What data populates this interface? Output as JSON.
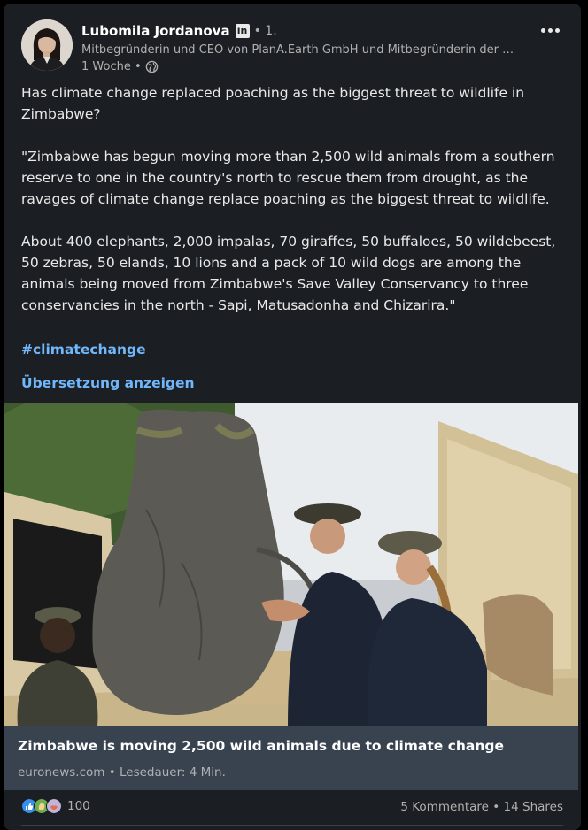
{
  "post": {
    "author_name": "Lubomila Jordanova",
    "linkedin_badge": "in",
    "degree": "• 1.",
    "headline": "Mitbegründerin und CEO von PlanA.Earth GmbH und Mitbegründerin der …",
    "time": "1 Woche •",
    "globe_icon": "globe-icon",
    "more_icon": "more-horizontal-icon",
    "text_p1": "Has climate change replaced poaching as the biggest threat to wildlife in Zimbabwe?",
    "text_p2": "\"Zimbabwe has begun moving more than 2,500 wild animals from a southern reserve to one in the country's north to rescue them from drought, as the ravages of climate change replace poaching as the biggest threat to wildlife.",
    "text_p3": "About 400 elephants, 2,000 impalas, 70 giraffes, 50 buffaloes, 50 wildebeest, 50 zebras, 50 elands, 10 lions and a pack of 10 wild dogs are among the animals being moved from Zimbabwe's Save Valley Conservancy to three conservancies in the north - Sapi, Matusadonha and Chizarira.\"",
    "hashtag": "#climatechange",
    "translate": "Übersetzung anzeigen"
  },
  "article": {
    "title": "Zimbabwe is moving 2,500 wild animals due to climate change",
    "source": "euronews.com • Lesedauer: 4 Min."
  },
  "social": {
    "reaction_icons": [
      "like-icon",
      "celebrate-icon",
      "support-icon"
    ],
    "reactions_count": "100",
    "comments": "5 Kommentare",
    "separator": " • ",
    "shares": "14 Shares"
  },
  "colors": {
    "card_bg": "#1b1f23",
    "link_blue": "#71b7fb",
    "article_meta_bg": "#38434f"
  }
}
